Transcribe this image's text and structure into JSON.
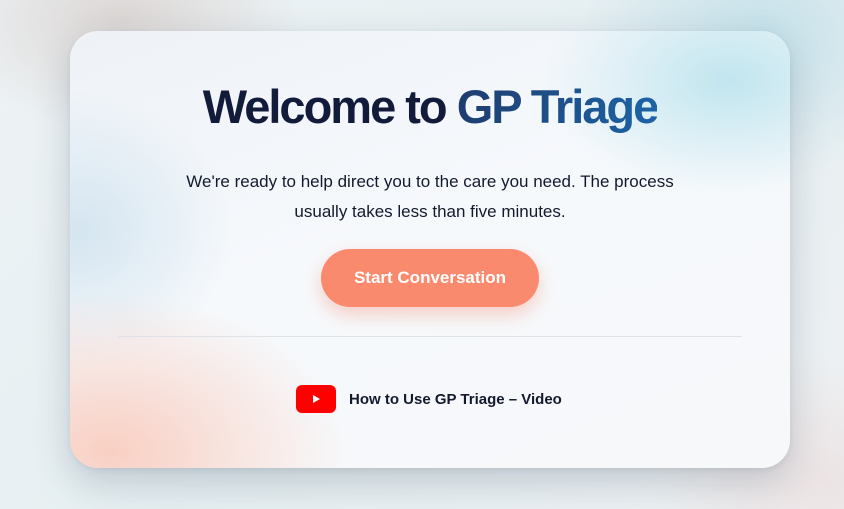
{
  "welcome": {
    "title_prefix": "Welcome to",
    "title_brand": "GP Triage",
    "intro_text": "We're ready to help direct you to the care you need. The process usually takes less than five minutes.",
    "start_button_label": "Start Conversation",
    "video_link_label": "How to Use GP Triage – Video",
    "video_icon": "youtube-play-icon"
  },
  "colors": {
    "title_dark": "#121b3a",
    "brand_gradient_start": "#1e3d6e",
    "brand_gradient_end": "#1d63a6",
    "start_button": "#fa8a6d",
    "youtube_red": "#ff0000"
  }
}
